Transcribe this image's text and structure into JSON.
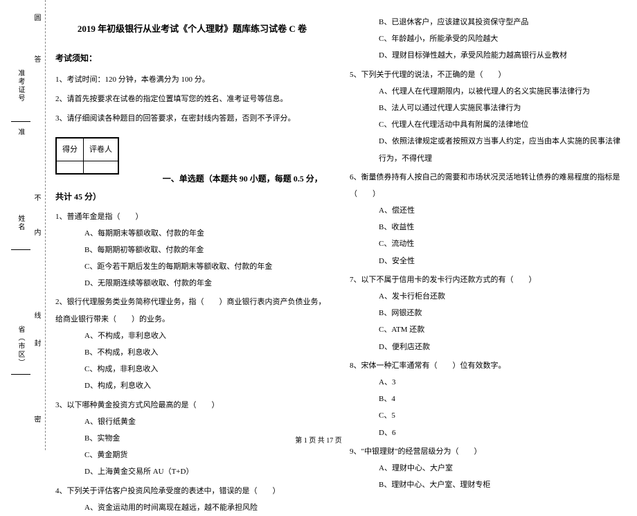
{
  "binding": {
    "l1": "圆",
    "l2": "答",
    "l3": "准考证号",
    "l4": "准",
    "l5": "不",
    "l6": "姓名",
    "l7": "内",
    "l8": "线",
    "l9": "省（市区）",
    "l10": "封",
    "l11": "密"
  },
  "title": "2019 年初级银行从业考试《个人理财》题库练习试卷 C 卷",
  "notice": {
    "heading": "考试须知：",
    "items": [
      "1、考试时间：120 分钟，本卷满分为 100 分。",
      "2、请首先按要求在试卷的指定位置填写您的姓名、准考证号等信息。",
      "3、请仔细阅读各种题目的回答要求，在密封线内答题，否则不予评分。"
    ]
  },
  "score_table": {
    "h1": "得分",
    "h2": "评卷人"
  },
  "section1": "一、单选题（本题共 90 小题，每题 0.5 分，共计 45 分）",
  "questions_left": [
    {
      "text": "1、普通年金是指（　　）",
      "opts": [
        "A、每期期末等额收取、付款的年金",
        "B、每期期初等额收取、付款的年金",
        "C、距今若干期后发生的每期期末等额收取、付款的年金",
        "D、无限期连续等额收取、付款的年金"
      ]
    },
    {
      "text": "2、银行代理服务类业务简称代理业务，指（　　）商业银行表内资产负债业务，给商业银行带来（　　）的业务。",
      "opts": [
        "A、不构成，非利息收入",
        "B、不构成，利息收入",
        "C、构成，非利息收入",
        "D、构成，利息收入"
      ]
    },
    {
      "text": "3、以下哪种黄金投资方式风险最高的是（　　）",
      "opts": [
        "A、银行纸黄金",
        "B、实物金",
        "C、黄金期货",
        "D、上海黄金交易所 AU（T+D）"
      ]
    },
    {
      "text": "4、下列关于评估客户投资风险承受度的表述中，错误的是（　　）",
      "opts": [
        "A、资金运动用的时间离现在越远，越不能承担风险"
      ]
    }
  ],
  "questions_right_cont": [
    "B、已退休客户，应该建议其投资保守型产品",
    "C、年龄越小，所能承受的风险越大",
    "D、理财目标弹性越大，承受风险能力越高银行从业教材"
  ],
  "questions_right": [
    {
      "text": "5、下列关于代理的说法，不正确的是（　　）",
      "opts": [
        "A、代理人在代理期限内，以被代理人的名义实施民事法律行为",
        "B、法人可以通过代理人实施民事法律行为",
        "C、代理人在代理活动中具有附属的法律地位",
        "D、依照法律规定或者按照双方当事人约定，应当由本人实施的民事法律行为，不得代理"
      ]
    },
    {
      "text": "6、衡量债券持有人按自己的需要和市场状况灵活地转让债券的难易程度的指标是（　　）",
      "opts": [
        "A、偿还性",
        "B、收益性",
        "C、流动性",
        "D、安全性"
      ]
    },
    {
      "text": "7、以下不属于信用卡的发卡行内还款方式的有（　　）",
      "opts": [
        "A、发卡行柜台还款",
        "B、网银还款",
        "C、ATM 还款",
        "D、便利店还款"
      ]
    },
    {
      "text": "8、宋体一种汇率通常有（　　）位有效数字。",
      "opts": [
        "A、3",
        "B、4",
        "C、5",
        "D、6"
      ]
    },
    {
      "text": "9、\"中银理财\"的经营层级分为（　　）",
      "opts": [
        "A、理财中心、大户室",
        "B、理财中心、大户室、理财专柜"
      ]
    }
  ],
  "footer": "第 1 页 共 17 页"
}
